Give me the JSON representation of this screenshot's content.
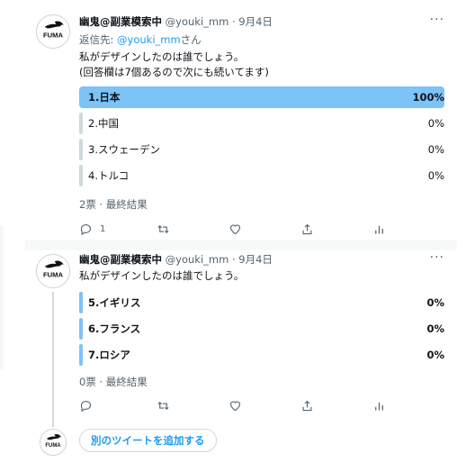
{
  "tweets": [
    {
      "author_name": "幽鬼@副業模索中",
      "handle_date": "@youki_mm · 9月4日",
      "more_glyph": "···",
      "reply_label": "返信先:",
      "reply_handle": "@youki_mm",
      "reply_suffix": "さん",
      "text_line1": "私がデザインしたのは誰でしょう。",
      "text_line2": "(回答欄は7個あるので次にも続いてます)",
      "poll": {
        "options": [
          {
            "label": "1.日本",
            "percent_text": "100%",
            "fraction": 1.0
          },
          {
            "label": "2.中国",
            "percent_text": "0%",
            "fraction": 0.0
          },
          {
            "label": "3.スウェーデン",
            "percent_text": "0%",
            "fraction": 0.0
          },
          {
            "label": "4.トルコ",
            "percent_text": "0%",
            "fraction": 0.0
          }
        ],
        "footer": "2票 · 最終結果"
      },
      "actions": {
        "reply_count": "1"
      }
    },
    {
      "author_name": "幽鬼@副業模索中",
      "handle_date": "@youki_mm · 9月4日",
      "more_glyph": "···",
      "text_line1": "私がデザインしたのは誰でしょう。",
      "poll": {
        "options": [
          {
            "label": "5.イギリス",
            "percent_text": "0%",
            "fraction": 0.0
          },
          {
            "label": "6.フランス",
            "percent_text": "0%",
            "fraction": 0.0
          },
          {
            "label": "7.ロシア",
            "percent_text": "0%",
            "fraction": 0.0
          }
        ],
        "footer": "0票 · 最終結果"
      }
    }
  ],
  "add_tweet_label": "別のツイートを追加する",
  "avatar_logo_text": "FUMA",
  "icons": {
    "reply": "reply-icon",
    "retweet": "retweet-icon",
    "like": "heart-icon",
    "share": "share-icon",
    "analytics": "analytics-icon"
  },
  "colors": {
    "accent": "#1d9bf0",
    "winner_bar": "#7cc3f7",
    "loser_bar": "#cfd9de",
    "muted_text": "#536471"
  }
}
